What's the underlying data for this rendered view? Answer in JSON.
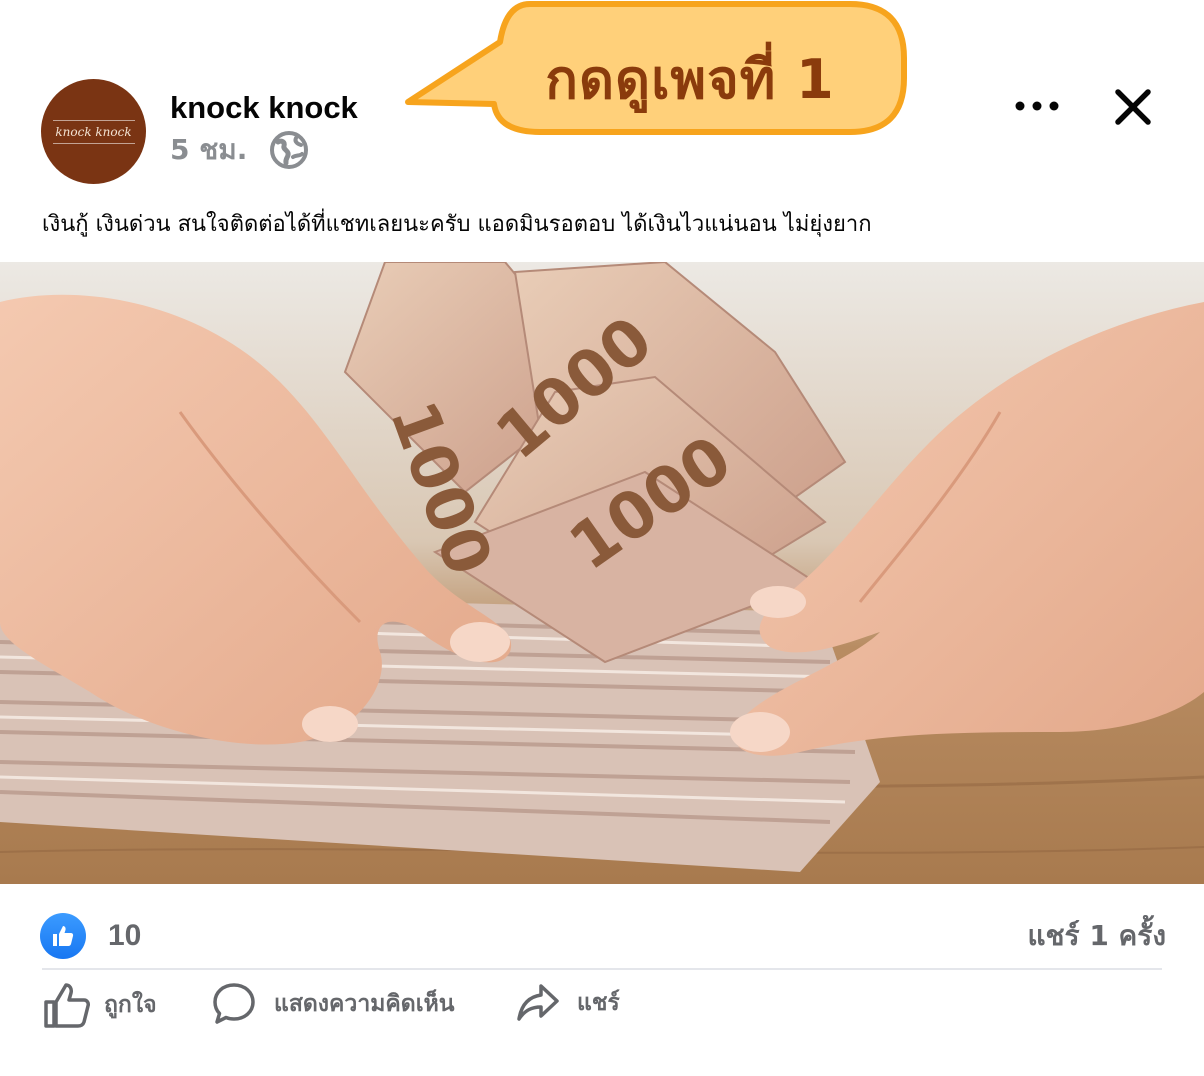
{
  "header": {
    "avatar_text": "knock knock",
    "page_name": "knock knock",
    "time": "5 ชม.",
    "privacy_icon": "globe-icon",
    "more_icon": "more-horizontal-icon",
    "close_icon": "close-icon"
  },
  "callout": {
    "text": "กดดูเพจที่ 1",
    "fill_color": "#ffd07a",
    "border_color": "#f7a41d",
    "text_color": "#8a3b0c"
  },
  "post": {
    "text": "เงินกู้ เงินด่วน สนใจติดต่อได้ที่แชทเลยนะครับ แอดมินรอตอบ ได้เงินไวแน่นอน ไม่ยุ่งยาก",
    "banknote_label": "1000"
  },
  "stats": {
    "like_count": "10",
    "share_count": "แชร์ 1 ครั้ง",
    "like_color": "#1877f2"
  },
  "actions": [
    {
      "label": "ถูกใจ",
      "icon": "thumbs-up-icon"
    },
    {
      "label": "แสดงความคิดเห็น",
      "icon": "comment-icon"
    },
    {
      "label": "แชร์",
      "icon": "share-icon"
    }
  ]
}
